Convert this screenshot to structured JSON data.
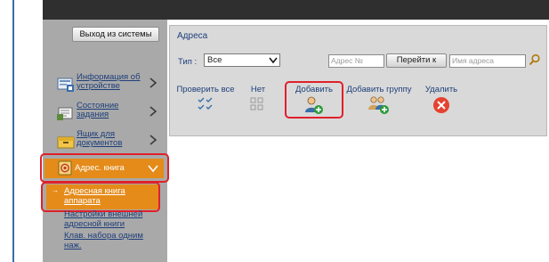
{
  "header": {
    "logout_label": "Выход из системы"
  },
  "sidebar": {
    "items": [
      {
        "label": "Информация об устройстве",
        "icon": "device-info-icon"
      },
      {
        "label": "Состояние задания",
        "icon": "job-status-icon"
      },
      {
        "label": "Ящик для документов",
        "icon": "document-box-icon"
      },
      {
        "label": "Адрес. книга",
        "icon": "address-book-icon"
      }
    ],
    "sub_items": [
      {
        "label": "Адресная книга аппарата",
        "arrow": "→"
      },
      {
        "label": "Настройки внешней адресной книги"
      },
      {
        "label": "Клав. набора одним наж."
      }
    ]
  },
  "panel": {
    "title": "Адреса",
    "type_label": "Тип :",
    "type_value": "Все",
    "address_no_placeholder": "Адрес №",
    "goto_label": "Перейти к",
    "address_name_placeholder": "Имя адреса"
  },
  "actions": {
    "check_all": "Проверить все",
    "none": "Нет",
    "add": "Добавить",
    "add_group": "Добавить группу",
    "delete": "Удалить"
  },
  "colors": {
    "sidebar_bg": "#a9a9a9",
    "active_orange": "#e48b1a",
    "highlight_red": "#e0202a",
    "link_blue": "#1e3f7a",
    "panel_bg": "#d9d9d9",
    "topbar_dark": "#2f2f2f"
  }
}
